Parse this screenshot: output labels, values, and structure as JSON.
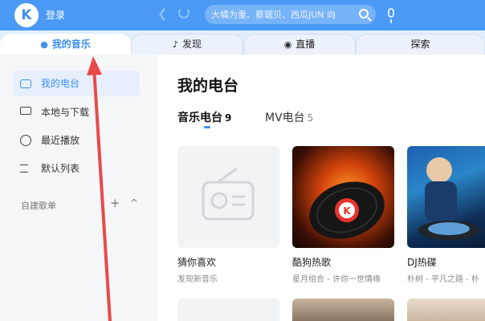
{
  "header": {
    "logo_letter": "K",
    "login_label": "登录",
    "search_placeholder": "大橘为重、蔡琚贝、西瓜JUN 向"
  },
  "tabs": [
    {
      "label": "我的音乐",
      "active": true
    },
    {
      "label": "发现",
      "active": false
    },
    {
      "label": "直播",
      "active": false
    },
    {
      "label": "探索",
      "active": false
    }
  ],
  "sidebar": {
    "items": [
      {
        "label": "我的电台",
        "icon": "radio-icon",
        "active": true
      },
      {
        "label": "本地与下载",
        "icon": "monitor-icon",
        "active": false
      },
      {
        "label": "最近播放",
        "icon": "clock-icon",
        "active": false
      },
      {
        "label": "默认列表",
        "icon": "playlist-icon",
        "active": false
      }
    ],
    "playlist_section": "自建歌单",
    "add_symbol": "+",
    "collapse_symbol": "^"
  },
  "main": {
    "title": "我的电台",
    "subtabs": [
      {
        "label": "音乐电台",
        "count": "9",
        "active": true
      },
      {
        "label": "MV电台",
        "count": "5",
        "active": false
      }
    ],
    "cards": [
      {
        "title": "猜你喜欢",
        "subtitle": "发现新音乐"
      },
      {
        "title": "酷狗热歌",
        "subtitle": "星月组合 - 许你一世情缘"
      },
      {
        "title": "DJ热碟",
        "subtitle": "朴树 - 平凡之路 - 朴"
      }
    ]
  },
  "colors": {
    "accent": "#3f8ff0",
    "header_bg": "#4a9af5",
    "annotation_arrow": "#e84a4a"
  }
}
